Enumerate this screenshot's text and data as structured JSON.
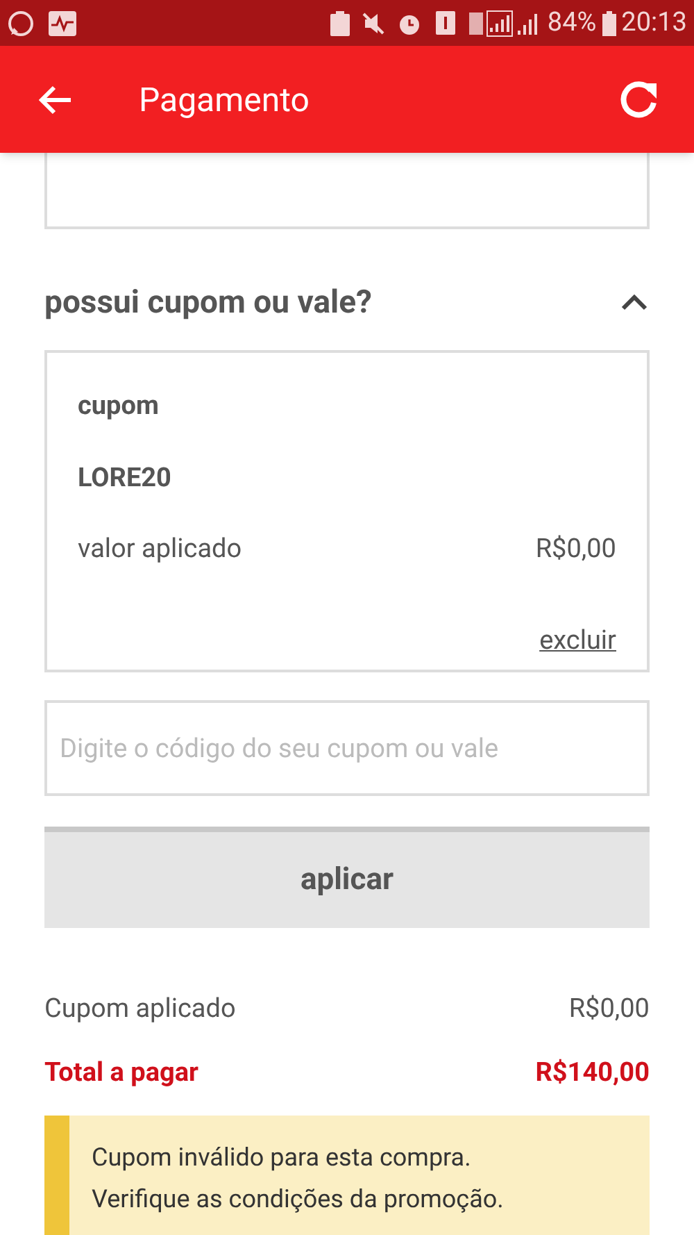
{
  "status_bar": {
    "battery": "84%",
    "time": "20:13"
  },
  "app_bar": {
    "title": "Pagamento"
  },
  "coupon_section": {
    "title": "possui cupom ou vale?",
    "expanded": true,
    "applied_coupon": {
      "label": "cupom",
      "code": "LORE20",
      "value_label": "valor aplicado",
      "value": "R$0,00",
      "remove_link": "excluir"
    },
    "input": {
      "placeholder": "Digite o código do seu cupom ou vale"
    },
    "apply_button": "aplicar"
  },
  "summary": [
    {
      "label": "Cupom aplicado",
      "value": "R$0,00",
      "kind": "normal"
    },
    {
      "label": "Total a pagar",
      "value": "R$140,00",
      "kind": "total"
    }
  ],
  "alert": {
    "lines": [
      "Cupom inválido para esta compra.",
      "Verifique as condições da promoção."
    ]
  }
}
